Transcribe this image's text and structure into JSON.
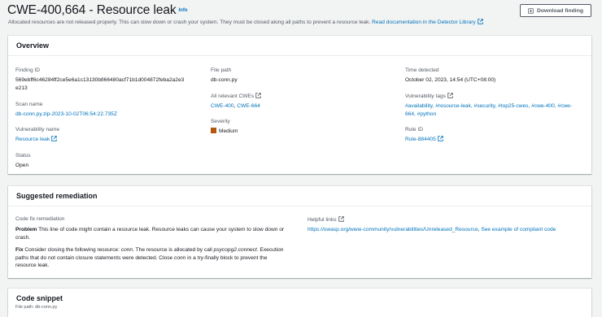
{
  "header": {
    "title": "CWE-400,664 - Resource leak",
    "info": "Info",
    "subtitle": "Allocated resources are not released properly. This can slow down or crash your system. They must be closed along all paths to prevent a resource leak.",
    "doc_link": "Read documentation in the Detector Library",
    "download_label": "Download finding"
  },
  "overview": {
    "heading": "Overview",
    "finding_id_label": "Finding ID",
    "finding_id_line1": "569ebff6c46284ff2ce5e6a1c13130b866480acf71b1d004872feba2a2e3",
    "finding_id_line2": "e213",
    "scan_name_label": "Scan name",
    "scan_name": "db-conn.py.zip-2023-10-02T06:54:22.735Z",
    "vuln_name_label": "Vulnerability name",
    "vuln_name": "Resource leak",
    "status_label": "Status",
    "status": "Open",
    "file_path_label": "File path",
    "file_path": "db-conn.py",
    "cwes_label": "All relevant CWEs",
    "cwe1": "CWE-400",
    "cwe2": "CWE-664",
    "severity_label": "Severity",
    "severity": "Medium",
    "time_label": "Time detected",
    "time": "October 02, 2023, 14:54 (UTC+08:00)",
    "tags_label": "Vulnerability tags",
    "tags_line1": "#availability, #resource-leak, #security, #top25-cwes, #cwe-400, #cwe-",
    "tags_line2": "664, #python",
    "rule_label": "Rule ID",
    "rule": "Rule-884405"
  },
  "remediation": {
    "heading": "Suggested remediation",
    "code_fix_label": "Code fix remediation",
    "problem_label": "Problem",
    "problem_line1": "This line of code might contain a resource leak. Resource leaks can cause your system to slow down or",
    "problem_line2": "crash.",
    "fix_label": "Fix",
    "fix_1a": "Consider closing the following resource:",
    "fix_1b": "conn",
    "fix_1c": ". The resource is allocated by call",
    "fix_1d": "psycopg2.connect",
    "fix_1e": ". Execution",
    "fix_2": "paths that do not contain closure statements were detected. Close",
    "fix_2b": "conn",
    "fix_2c": "in a try-finally block to prevent the",
    "fix_3": "resource leak.",
    "helpful_label": "Helpful links",
    "link1": "https://owasp.org/www-community/vulnerabilities/Unreleased_Resource",
    "link2": "See example of compliant code"
  },
  "snippet": {
    "heading": "Code snippet",
    "file_path": "File path: db-conn.py"
  },
  "colors": {
    "link": "#0073bb",
    "severity_medium": "#b5560f",
    "background": "#f2f3f3"
  },
  "icons": [
    "external-link-icon",
    "download-icon"
  ]
}
